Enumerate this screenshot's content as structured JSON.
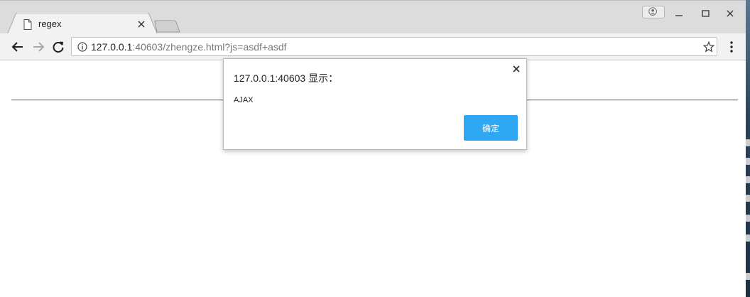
{
  "browser": {
    "tab_title": "regex",
    "url_host": "127.0.0.1",
    "url_rest": ":40603/zhengze.html?js=asdf+asdf"
  },
  "dialog": {
    "title": "127.0.0.1:40603 显示：",
    "message": "AJAX",
    "ok_label": "确定"
  },
  "icons": {
    "tab": "document-icon",
    "tab_close": "close-icon",
    "back": "back-arrow-icon",
    "forward": "forward-arrow-icon",
    "reload": "reload-icon",
    "site_info": "info-icon",
    "bookmark": "star-icon",
    "menu": "kebab-menu-icon",
    "profile": "profile-icon",
    "minimize": "minimize-icon",
    "maximize": "maximize-icon",
    "close_window": "close-window-icon"
  },
  "colors": {
    "dialog_button": "#2ea8f3",
    "url_rest": "#777777"
  }
}
